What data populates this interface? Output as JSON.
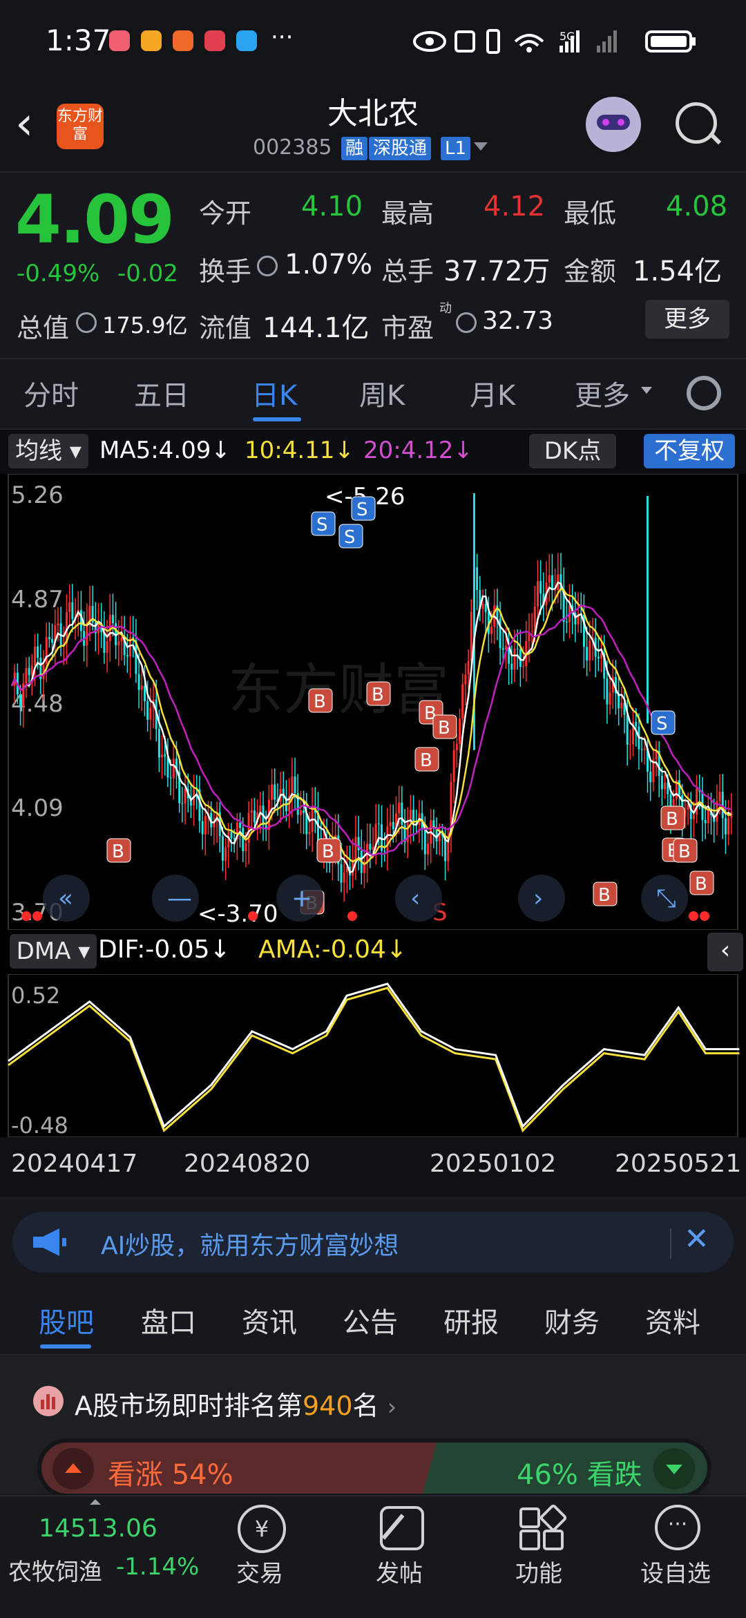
{
  "status": {
    "time": "1:37",
    "more": "···"
  },
  "header": {
    "stock_name": "大北农",
    "code": "002385",
    "tags": [
      "融",
      "深股通",
      "L1"
    ],
    "logo_text": "东方财富"
  },
  "quote": {
    "price": "4.09",
    "change_pct": "-0.49%",
    "change": "-0.02",
    "open_label": "今开",
    "open": "4.10",
    "high_label": "最高",
    "high": "4.12",
    "low_label": "最低",
    "low": "4.08",
    "turnover_label": "换手",
    "turnover": "1.07%",
    "volume_label": "总手",
    "volume": "37.72万",
    "amount_label": "金额",
    "amount": "1.54亿",
    "mcap_label": "总值",
    "mcap": "175.9亿",
    "float_label": "流值",
    "float": "144.1亿",
    "pe_label": "市盈",
    "pe_sup": "动",
    "pe": "32.73",
    "more_label": "更多"
  },
  "tabs": [
    "分时",
    "五日",
    "日K",
    "周K",
    "月K",
    "更多"
  ],
  "active_tab": "日K",
  "ma_bar": {
    "selector": "均线",
    "ma5": "MA5:4.09↓",
    "ma10": "10:4.11↓",
    "ma20": "20:4.12↓",
    "dk": "DK点",
    "adj": "不复权"
  },
  "kline": {
    "y_labels": [
      "5.26",
      "4.87",
      "4.48",
      "4.09",
      "3.70"
    ],
    "max_label": "<-5.26",
    "min_label": "<-3.70",
    "watermark": "东方财富",
    "signals_s": [
      "S",
      "S",
      "S",
      "S",
      "S"
    ],
    "signals_b": [
      "B",
      "B",
      "B",
      "B",
      "B",
      "B",
      "B",
      "B",
      "B",
      "B",
      "B",
      "B",
      "B"
    ]
  },
  "dma_bar": {
    "selector": "DMA",
    "dif": "DIF:-0.05↓",
    "ama": "AMA:-0.04↓"
  },
  "dma": {
    "y_labels": [
      "0.52",
      "-0.48"
    ]
  },
  "x_dates": [
    "20240417",
    "20240820",
    "20250102",
    "20250521"
  ],
  "banner": {
    "text": "AI炒股，就用东方财富妙想"
  },
  "bottom_tabs": [
    "股吧",
    "盘口",
    "资讯",
    "公告",
    "研报",
    "财务",
    "资料"
  ],
  "active_bottom_tab": "股吧",
  "rank": {
    "prefix": "A股市场即时排名第",
    "number": "940",
    "suffix": "名",
    "bull_label": "看涨",
    "bull_pct": "54%",
    "bear_pct": "46%",
    "bear_label": "看跌"
  },
  "bottom_nav": {
    "index_value": "14513.06",
    "index_name": "农牧饲渔",
    "index_change": "-1.14%",
    "items": [
      "交易",
      "发帖",
      "功能",
      "设自选"
    ]
  },
  "colors": {
    "up": "#e63232",
    "down": "#27c43b",
    "accent": "#3a86f0",
    "ma5": "#ffffff",
    "ma10": "#f7e13a",
    "ma20": "#c020c0"
  }
}
